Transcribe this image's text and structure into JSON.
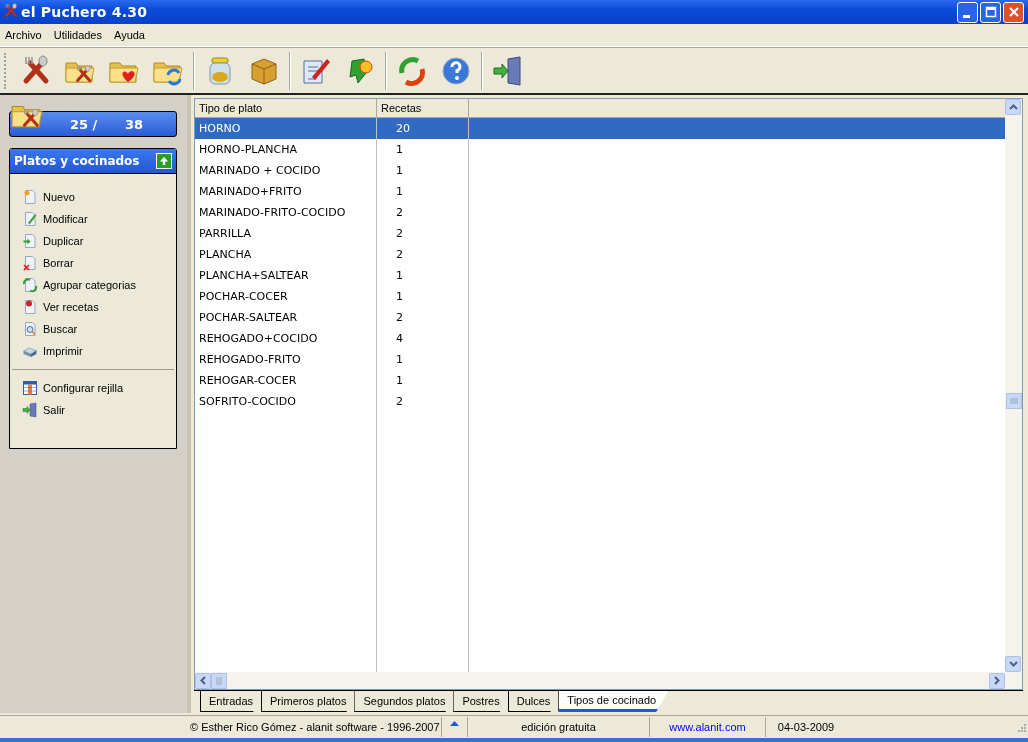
{
  "window": {
    "title": "el Puchero 4.30"
  },
  "menu": [
    "Archivo",
    "Utilidades",
    "Ayuda"
  ],
  "sidebar": {
    "counter": {
      "current": "25 /",
      "total": "38"
    },
    "panel": {
      "title": "Platos y cocinados",
      "groups": [
        [
          "Nuevo",
          "Modificar",
          "Duplicar",
          "Borrar",
          "Agrupar categorias",
          "Ver recetas",
          "Buscar",
          "Imprimir"
        ],
        [
          "Configurar rejilla",
          "Salir"
        ]
      ]
    }
  },
  "table": {
    "columns": [
      "Tipo de plato",
      "Recetas"
    ],
    "rows": [
      {
        "cells": [
          "HORNO",
          "20"
        ],
        "selected": true
      },
      {
        "cells": [
          "HORNO-PLANCHA",
          "1"
        ],
        "selected": false
      },
      {
        "cells": [
          "MARINADO + COCIDO",
          "1"
        ],
        "selected": false
      },
      {
        "cells": [
          "MARINADO+FRITO",
          "1"
        ],
        "selected": false
      },
      {
        "cells": [
          "MARINADO-FRITO-COCIDO",
          "2"
        ],
        "selected": false
      },
      {
        "cells": [
          "PARRILLA",
          "2"
        ],
        "selected": false
      },
      {
        "cells": [
          "PLANCHA",
          "2"
        ],
        "selected": false
      },
      {
        "cells": [
          "PLANCHA+SALTEAR",
          "1"
        ],
        "selected": false
      },
      {
        "cells": [
          "POCHAR-COCER",
          "1"
        ],
        "selected": false
      },
      {
        "cells": [
          "POCHAR-SALTEAR",
          "2"
        ],
        "selected": false
      },
      {
        "cells": [
          "REHOGADO+COCIDO",
          "4"
        ],
        "selected": false
      },
      {
        "cells": [
          "REHOGADO-FRITO",
          "1"
        ],
        "selected": false
      },
      {
        "cells": [
          "REHOGAR-COCER",
          "1"
        ],
        "selected": false
      },
      {
        "cells": [
          "SOFRITO-COCIDO",
          "2"
        ],
        "selected": false
      }
    ]
  },
  "tabs": [
    {
      "label": "Entradas",
      "selected": false
    },
    {
      "label": "Primeros platos",
      "selected": false
    },
    {
      "label": "Segundos platos",
      "selected": false
    },
    {
      "label": "Postres",
      "selected": false
    },
    {
      "label": "Dulces",
      "selected": false
    },
    {
      "label": "Tipos de cocinado",
      "selected": true
    }
  ],
  "status_bar": {
    "copyright": "© Esther Rico Gómez - alanit software - 1996-2007",
    "edition": "edición gratuita",
    "link": "www.alanit.com",
    "date": "04-03-2009"
  }
}
